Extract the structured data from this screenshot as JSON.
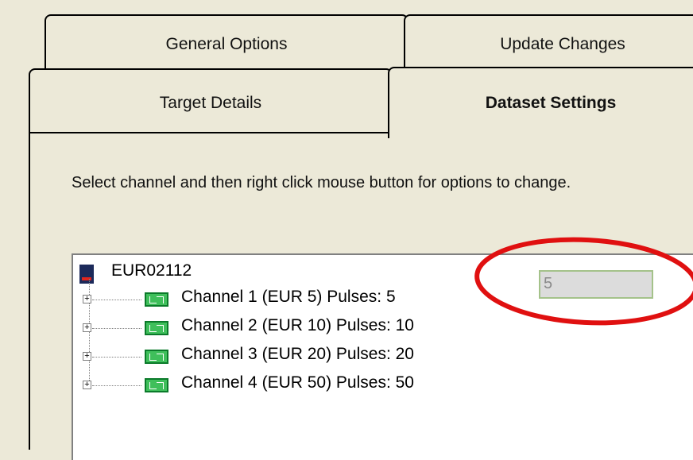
{
  "tabs": {
    "general_options": "General Options",
    "update_changes": "Update Changes",
    "target_details": "Target Details",
    "dataset_settings": "Dataset Settings"
  },
  "instruction": "Select channel and then right click mouse button for options to change.",
  "tree": {
    "root_label": "EUR02112",
    "channels": [
      {
        "label": "Channel 1 (EUR 5) Pulses: 5"
      },
      {
        "label": "Channel 2 (EUR 10) Pulses: 10"
      },
      {
        "label": "Channel 3 (EUR 20) Pulses: 20"
      },
      {
        "label": "Channel 4 (EUR 50) Pulses: 50"
      }
    ]
  },
  "value_field": {
    "value": "5"
  },
  "highlight_color": "#e01010"
}
